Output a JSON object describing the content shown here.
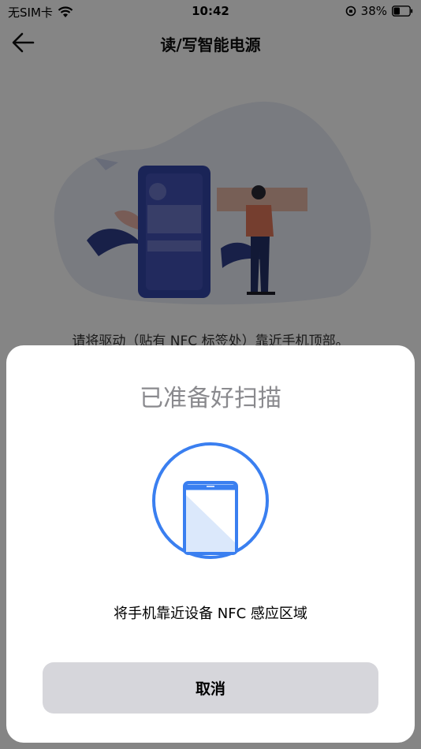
{
  "status_bar": {
    "carrier": "无SIM卡",
    "time": "10:42",
    "battery_percent": "38%",
    "battery_level": 0.38
  },
  "nav": {
    "title": "读/写智能电源"
  },
  "page": {
    "instruction": "请将驱动（贴有 NFC 标签处）靠近手机顶部。"
  },
  "sheet": {
    "title": "已准备好扫描",
    "message": "将手机靠近设备 NFC 感应区域",
    "cancel_label": "取消"
  },
  "colors": {
    "accent": "#3a7ff0",
    "sheet_title": "#8a8a8e",
    "cancel_bg": "#d6d6db"
  }
}
